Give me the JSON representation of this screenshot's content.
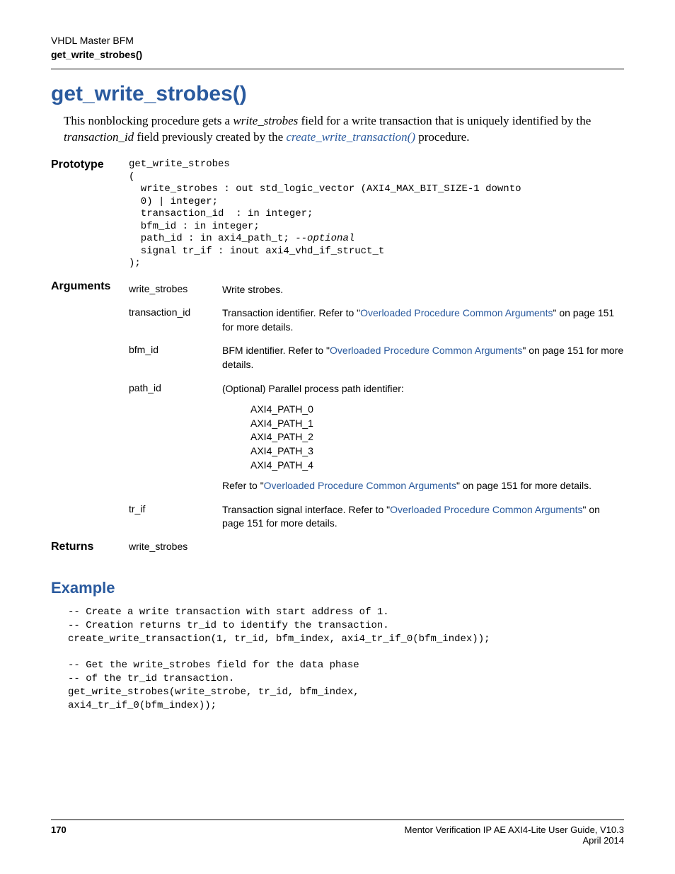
{
  "header": {
    "line1": "VHDL Master BFM",
    "line2": "get_write_strobes()"
  },
  "title": "get_write_strobes()",
  "intro": {
    "pre": "This nonblocking procedure gets a ",
    "i1": "write_strobes",
    "mid1": " field for a write transaction that is uniquely identified by the ",
    "i2": "transaction_id",
    "mid2": " field previously created by the ",
    "link": "create_write_transaction()",
    "post": " procedure."
  },
  "labels": {
    "prototype": "Prototype",
    "arguments": "Arguments",
    "returns": "Returns"
  },
  "prototype": {
    "l1": "get_write_strobes",
    "l2": "(",
    "l3": "  write_strobes : out std_logic_vector (AXI4_MAX_BIT_SIZE-1 downto",
    "l4": "  0) | integer;",
    "l5": "  transaction_id  : in integer;",
    "l6": "  bfm_id : in integer;",
    "l7a": "  path_id : in axi4_path_t; ",
    "l7b": "--optional",
    "l8": "  signal tr_if : inout axi4_vhd_if_struct_t",
    "l9": ");"
  },
  "args": {
    "write_strobes": {
      "name": "write_strobes",
      "desc": "Write strobes."
    },
    "transaction_id": {
      "name": "transaction_id",
      "pre": "Transaction identifier. Refer to \"",
      "link": "Overloaded Procedure Common Arguments",
      "post": "\" on page 151 for more details."
    },
    "bfm_id": {
      "name": "bfm_id",
      "pre": "BFM identifier. Refer to \"",
      "link": "Overloaded Procedure Common Arguments",
      "post": "\" on page 151 for more details."
    },
    "path_id": {
      "name": "path_id",
      "intro": "(Optional) Parallel process path identifier:",
      "p0": "AXI4_PATH_0",
      "p1": "AXI4_PATH_1",
      "p2": "AXI4_PATH_2",
      "p3": "AXI4_PATH_3",
      "p4": "AXI4_PATH_4",
      "pre": "Refer to \"",
      "link": "Overloaded Procedure Common Arguments",
      "post": "\" on page 151 for more details."
    },
    "tr_if": {
      "name": "tr_if",
      "pre": "Transaction signal interface. Refer to \"",
      "link": "Overloaded Procedure Common Arguments",
      "post": "\" on page 151 for more details."
    }
  },
  "returns": {
    "value": "write_strobes"
  },
  "example": {
    "heading": "Example",
    "code": "-- Create a write transaction with start address of 1.\n-- Creation returns tr_id to identify the transaction.\ncreate_write_transaction(1, tr_id, bfm_index, axi4_tr_if_0(bfm_index));\n\n-- Get the write_strobes field for the data phase\n-- of the tr_id transaction.\nget_write_strobes(write_strobe, tr_id, bfm_index,\naxi4_tr_if_0(bfm_index));"
  },
  "footer": {
    "page": "170",
    "guide": "Mentor Verification IP AE AXI4-Lite User Guide, V10.3",
    "date": "April 2014"
  }
}
